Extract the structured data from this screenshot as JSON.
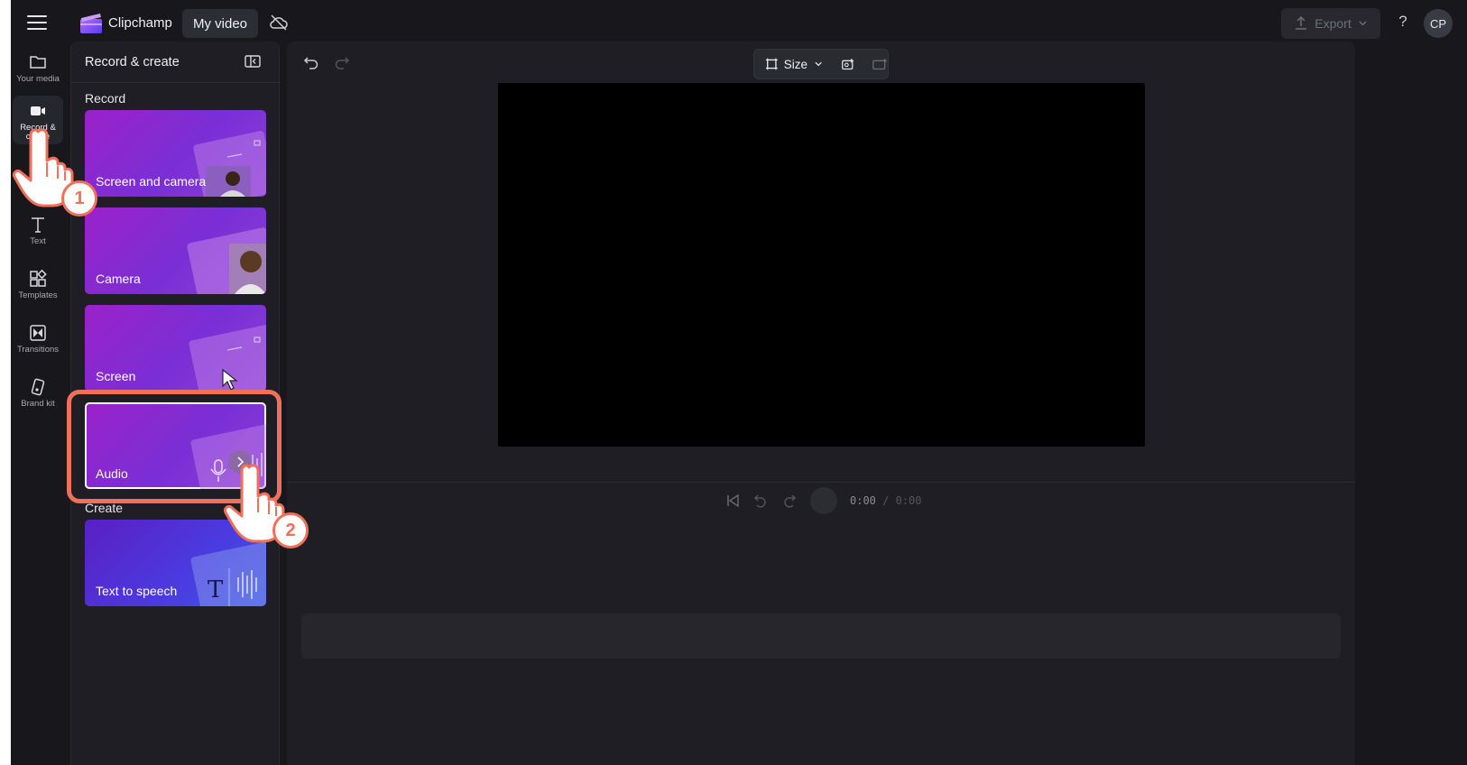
{
  "topbar": {
    "brand": "Clipchamp",
    "project_title": "My video",
    "export_label": "Export",
    "help_label": "?",
    "avatar_initials": "CP"
  },
  "rail": {
    "items": [
      {
        "label": "Your media",
        "icon": "folder-icon"
      },
      {
        "label": "Record & create",
        "icon": "video-camera-icon",
        "active": true
      },
      {
        "label": "Text",
        "icon": "text-icon"
      },
      {
        "label": "Templates",
        "icon": "templates-icon"
      },
      {
        "label": "Transitions",
        "icon": "transitions-icon"
      },
      {
        "label": "Brand kit",
        "icon": "brand-kit-icon"
      }
    ]
  },
  "panel": {
    "title": "Record & create",
    "record_section": "Record",
    "create_section": "Create",
    "cards": [
      {
        "label": "Screen and camera"
      },
      {
        "label": "Camera"
      },
      {
        "label": "Screen"
      },
      {
        "label": "Audio",
        "selected": true
      },
      {
        "label": "Text to speech"
      }
    ]
  },
  "toolbar": {
    "size_label": "Size"
  },
  "player": {
    "current_time": "0:00",
    "separator": " / ",
    "total_time": "0:00"
  },
  "annotations": {
    "step1": "1",
    "step2": "2"
  },
  "colors": {
    "app_bg": "#17171c",
    "panel_bg": "#1e1e24",
    "card_purple": "#8a2fd0",
    "card_blue": "#4a3ce0",
    "highlight": "#f0705a"
  }
}
